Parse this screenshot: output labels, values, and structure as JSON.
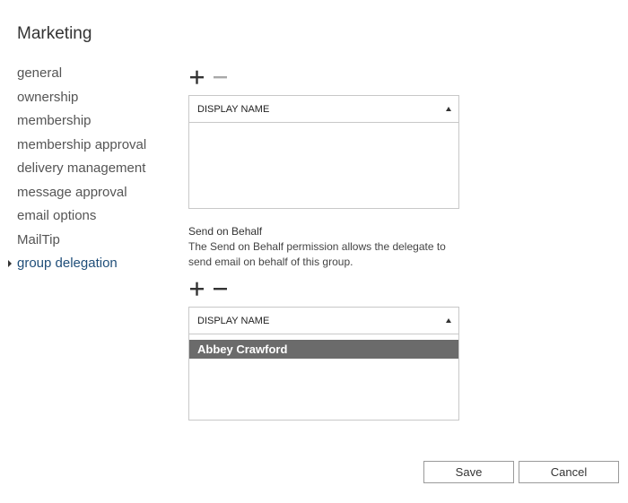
{
  "page": {
    "title": "Marketing"
  },
  "nav": {
    "items": [
      {
        "label": "general"
      },
      {
        "label": "ownership"
      },
      {
        "label": "membership"
      },
      {
        "label": "membership approval"
      },
      {
        "label": "delivery management"
      },
      {
        "label": "message approval"
      },
      {
        "label": "email options"
      },
      {
        "label": "MailTip"
      },
      {
        "label": "group delegation"
      }
    ],
    "selected": "group delegation"
  },
  "send_as": {
    "add_icon": "plus-icon",
    "remove_icon": "minus-icon",
    "column_header": "DISPLAY NAME",
    "rows": []
  },
  "send_on_behalf": {
    "label": "Send on Behalf",
    "description": "The Send on Behalf permission allows the delegate to send email on behalf of this group.",
    "add_icon": "plus-icon",
    "remove_icon": "minus-icon",
    "column_header": "DISPLAY NAME",
    "rows": [
      {
        "name": "Abbey Crawford",
        "selected": true
      }
    ]
  },
  "footer": {
    "save_label": "Save",
    "cancel_label": "Cancel"
  },
  "colors": {
    "selected_nav_text": "#1f4e79",
    "selected_row_bg": "#6b6b6b",
    "border": "#c8c8c8"
  }
}
